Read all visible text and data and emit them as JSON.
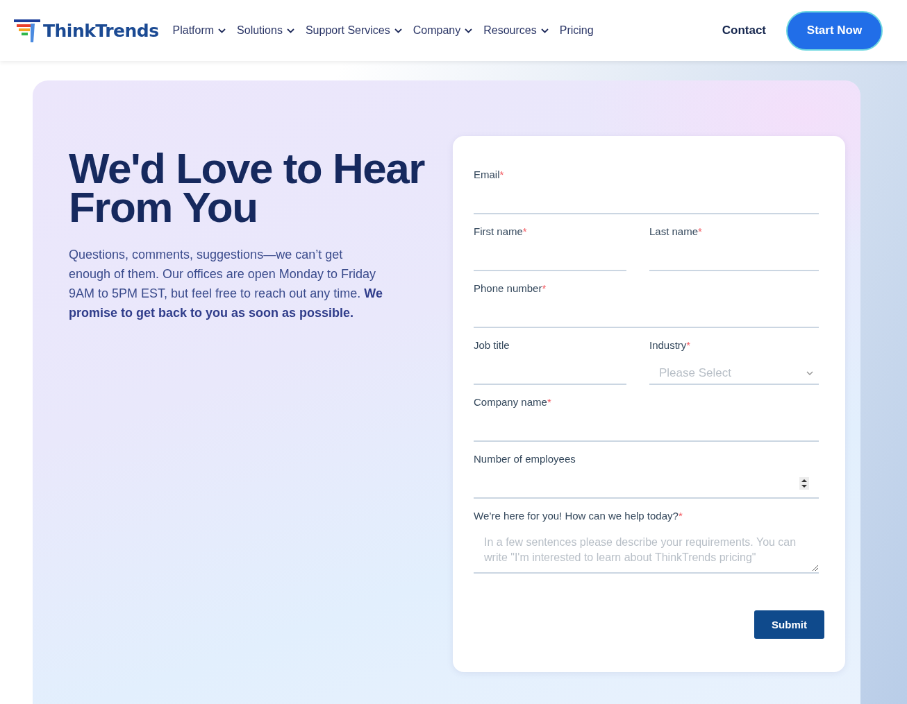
{
  "header": {
    "logo": "ThinkTrends",
    "nav": [
      {
        "label": "Platform",
        "has_menu": true
      },
      {
        "label": "Solutions",
        "has_menu": true
      },
      {
        "label": "Support Services",
        "has_menu": true
      },
      {
        "label": "Company",
        "has_menu": true
      },
      {
        "label": "Resources",
        "has_menu": true
      },
      {
        "label": "Pricing",
        "has_menu": false
      }
    ],
    "contact": "Contact",
    "cta": "Start Now"
  },
  "hero": {
    "title": "We'd Love to Hear From You",
    "text": "Questions, comments, suggestions—we can’t get enough of them. Our offices are open Monday to Friday 9AM to 5PM EST, but feel free to reach out any time. **We promise to get back to you as soon as possible.**"
  },
  "form": {
    "rows": [
      [
        {
          "kind": "text",
          "label": "Email",
          "asterisk": "*"
        }
      ],
      [
        {
          "kind": "text",
          "label": "First name",
          "asterisk": "*"
        },
        {
          "kind": "text",
          "label": "Last name",
          "asterisk": "*"
        }
      ],
      [
        {
          "kind": "text",
          "label": "Phone number",
          "asterisk": "*"
        }
      ],
      [
        {
          "kind": "text",
          "label": "Job title"
        },
        {
          "kind": "select",
          "label": "Industry",
          "asterisk": "*",
          "placeholder": "Please Select"
        }
      ],
      [
        {
          "kind": "text",
          "label": "Company name",
          "asterisk": "*"
        }
      ],
      [
        {
          "kind": "number",
          "label": "Number of employees"
        }
      ],
      [
        {
          "kind": "textarea",
          "label": "We’re here for you! How can we help today?",
          "asterisk": "*",
          "placeholder": "In a few sentences please describe your requirements. You can write \"I'm interested to learn about ThinkTrends pricing\""
        }
      ]
    ],
    "submit": "Submit"
  }
}
